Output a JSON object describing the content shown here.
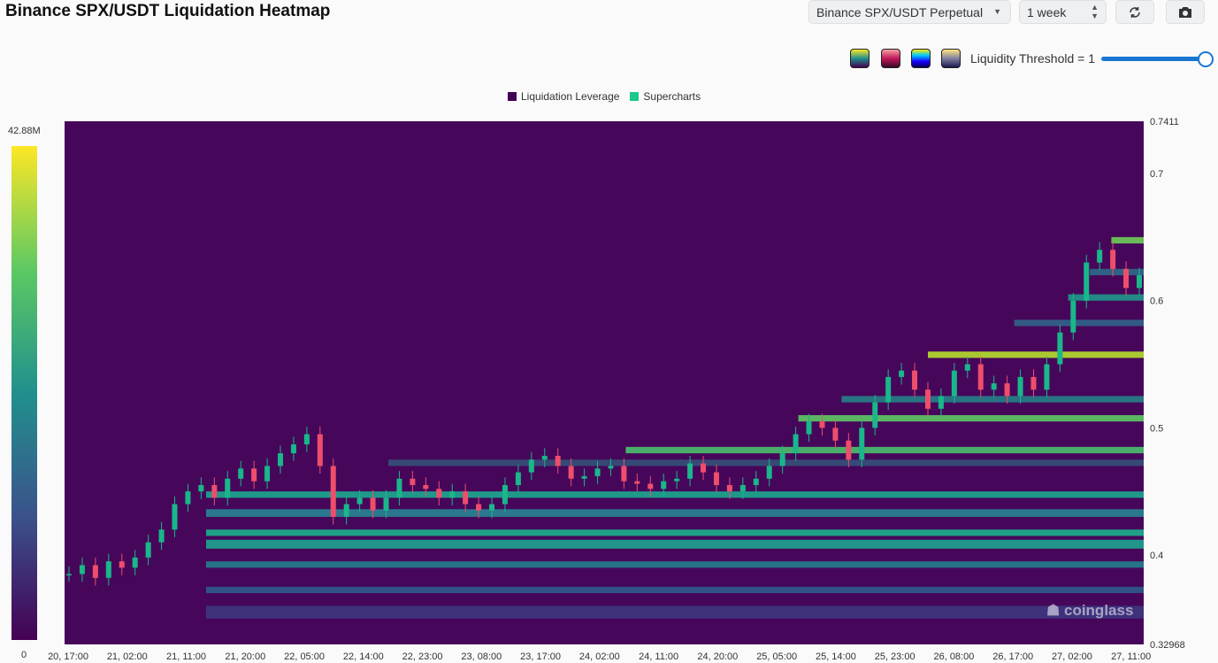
{
  "header": {
    "title": "Binance SPX/USDT Liquidation Heatmap",
    "pair_select": "Binance SPX/USDT Perpetual",
    "range_select": "1 week"
  },
  "controls": {
    "palettes": [
      "viridis",
      "rose",
      "blue-yellow",
      "navy-yellow"
    ],
    "threshold_label": "Liquidity Threshold = 1",
    "threshold_value": 1
  },
  "colorbar": {
    "max_label": "42.88M",
    "min_label": "0"
  },
  "watermark": "coinglass",
  "chart_data": {
    "type": "heatmap",
    "title": "Binance SPX/USDT Liquidation Heatmap",
    "legend": [
      {
        "name": "Liquidation Leverage",
        "color": "#440154"
      },
      {
        "name": "Supercharts",
        "color": "#1ac98a"
      }
    ],
    "legend_position": "top-center",
    "y_axis": {
      "min": 0.32968,
      "max": 0.7411,
      "ticks": [
        "0.7411",
        "0.7",
        "0.6",
        "0.5",
        "0.4",
        "0.32968"
      ],
      "tick_values": [
        0.7411,
        0.7,
        0.6,
        0.5,
        0.4,
        0.32968
      ],
      "position": "right"
    },
    "x_axis": {
      "ticks": [
        "20, 17:00",
        "21, 02:00",
        "21, 11:00",
        "21, 20:00",
        "22, 05:00",
        "22, 14:00",
        "22, 23:00",
        "23, 08:00",
        "23, 17:00",
        "24, 02:00",
        "24, 11:00",
        "24, 20:00",
        "25, 05:00",
        "25, 14:00",
        "25, 23:00",
        "26, 08:00",
        "26, 17:00",
        "27, 02:00",
        "27, 11:00"
      ]
    },
    "colorscale": {
      "min": 0,
      "max": "42.88M",
      "colors": [
        "#440154",
        "#3b528b",
        "#21908d",
        "#5dc963",
        "#fde725"
      ]
    },
    "price_path": [
      0.385,
      0.392,
      0.382,
      0.395,
      0.39,
      0.398,
      0.41,
      0.42,
      0.44,
      0.45,
      0.455,
      0.445,
      0.46,
      0.468,
      0.458,
      0.47,
      0.48,
      0.487,
      0.495,
      0.47,
      0.43,
      0.44,
      0.445,
      0.435,
      0.445,
      0.46,
      0.455,
      0.452,
      0.445,
      0.45,
      0.44,
      0.435,
      0.44,
      0.455,
      0.465,
      0.475,
      0.478,
      0.47,
      0.46,
      0.462,
      0.468,
      0.47,
      0.458,
      0.456,
      0.452,
      0.458,
      0.46,
      0.472,
      0.465,
      0.455,
      0.45,
      0.455,
      0.46,
      0.47,
      0.48,
      0.495,
      0.505,
      0.5,
      0.49,
      0.475,
      0.5,
      0.52,
      0.54,
      0.545,
      0.53,
      0.515,
      0.525,
      0.545,
      0.55,
      0.53,
      0.535,
      0.525,
      0.54,
      0.53,
      0.55,
      0.575,
      0.6,
      0.63,
      0.64,
      0.625,
      0.61,
      0.62
    ]
  }
}
